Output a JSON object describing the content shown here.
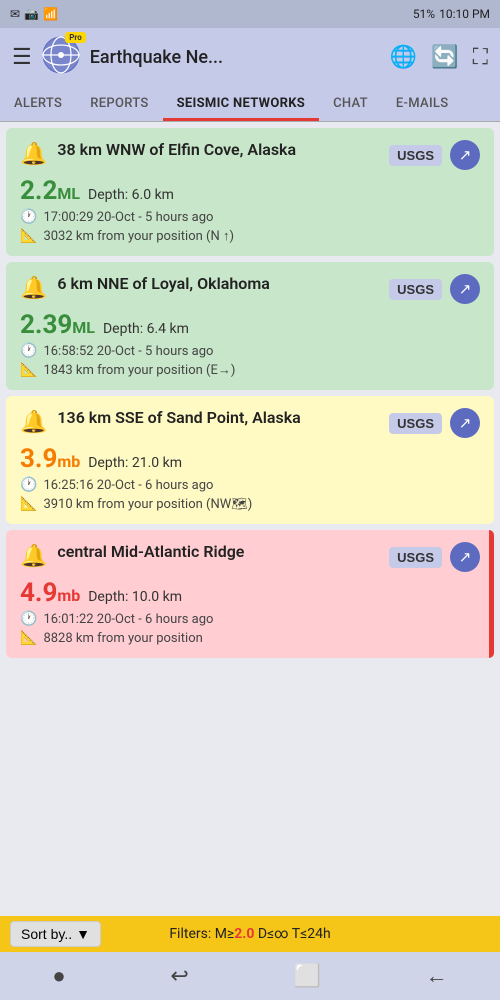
{
  "statusBar": {
    "leftIcons": [
      "✉",
      "📷",
      "📶"
    ],
    "battery": "51%",
    "time": "10:10 PM",
    "signalIcon": "📶"
  },
  "header": {
    "title": "Earthquake Ne...",
    "proBadge": "Pro"
  },
  "tabs": [
    {
      "id": "alerts",
      "label": "ALERTS",
      "active": false
    },
    {
      "id": "reports",
      "label": "REPORTS",
      "active": false
    },
    {
      "id": "seismic",
      "label": "SEISMIC NETWORKS",
      "active": true
    },
    {
      "id": "chat",
      "label": "CHAT",
      "active": false
    },
    {
      "id": "emails",
      "label": "E-MAILS",
      "active": false
    }
  ],
  "earthquakes": [
    {
      "id": "eq1",
      "title": "38 km WNW of Elfin Cove, Alaska",
      "magnitude": "2.2",
      "magUnit": "ML",
      "magColor": "green",
      "depth": "Depth: 6.0 km",
      "time": "17:00:29 20-Oct - 5 hours ago",
      "distance": "3032 km from your position (N ↑)",
      "source": "USGS",
      "color": "green"
    },
    {
      "id": "eq2",
      "title": "6 km NNE of Loyal, Oklahoma",
      "magnitude": "2.39",
      "magUnit": "ML",
      "magColor": "green",
      "depth": "Depth: 6.4 km",
      "time": "16:58:52 20-Oct - 5 hours ago",
      "distance": "1843 km from your position (E→)",
      "source": "USGS",
      "color": "green"
    },
    {
      "id": "eq3",
      "title": "136 km SSE of Sand Point, Alaska",
      "magnitude": "3.9",
      "magUnit": "mb",
      "magColor": "orange",
      "depth": "Depth: 21.0 km",
      "time": "16:25:16 20-Oct - 6 hours ago",
      "distance": "3910 km from your position (NW🗺)",
      "source": "USGS",
      "color": "yellow"
    },
    {
      "id": "eq4",
      "title": "central Mid-Atlantic Ridge",
      "magnitude": "4.9",
      "magUnit": "mb",
      "magColor": "red",
      "depth": "Depth: 10.0 km",
      "time": "16:01:22 20-Oct - 6 hours ago",
      "distance": "8828 km from your position",
      "source": "USGS",
      "color": "red"
    }
  ],
  "sortLabel": "Sort by..",
  "filters": {
    "prefix": "Filters: M≥",
    "magnitude": "2.0",
    "rest": " D≤∞ T≤24h"
  },
  "nav": {
    "icons": [
      "●",
      "↩",
      "⬜",
      "←"
    ]
  }
}
